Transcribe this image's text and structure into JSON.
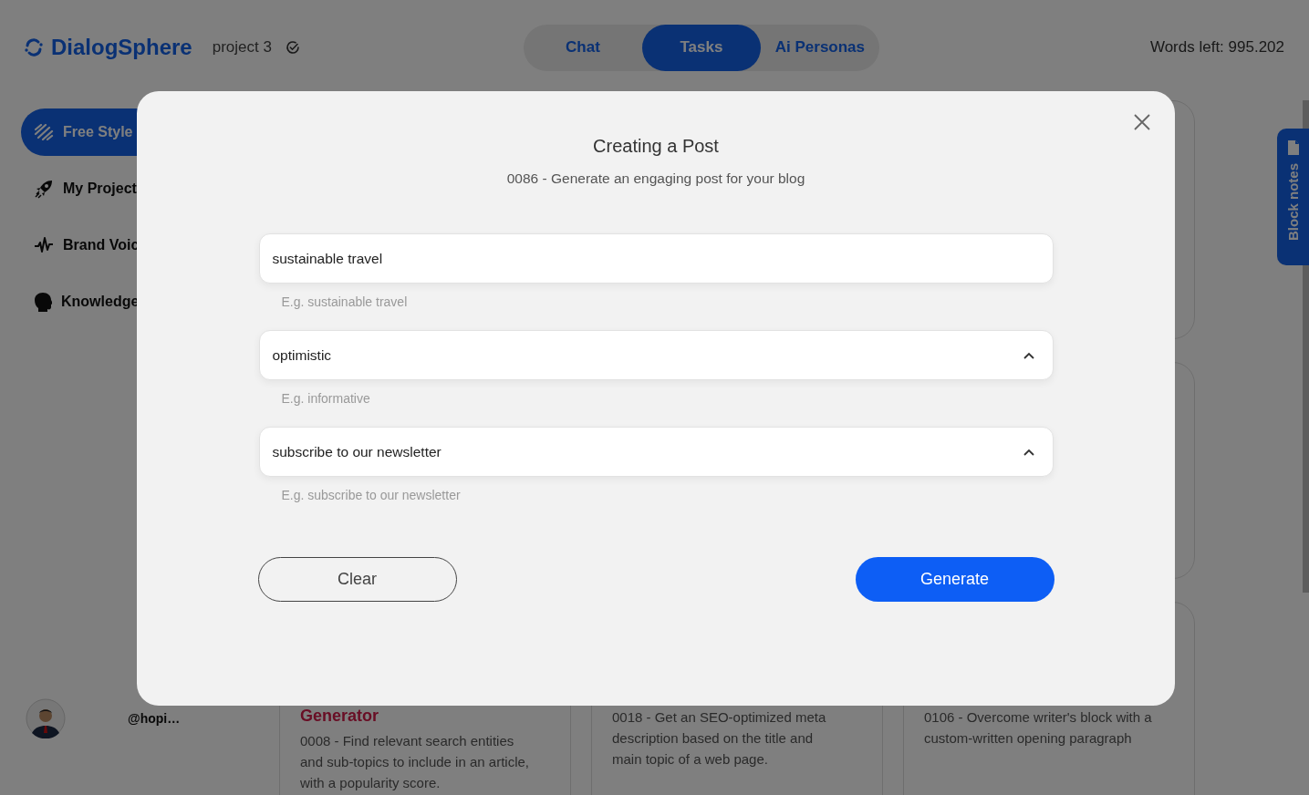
{
  "header": {
    "logo": "DialogSphere",
    "project": "project 3",
    "words_left": "Words left: 995.202"
  },
  "tabs": [
    {
      "label": "Chat",
      "selected": false
    },
    {
      "label": "Tasks",
      "selected": true
    },
    {
      "label": "Ai Personas",
      "selected": false
    }
  ],
  "sidebar": {
    "items": [
      {
        "label": "Free Style",
        "selected": true
      },
      {
        "label": "My Project",
        "selected": false
      },
      {
        "label": "Brand Voic",
        "selected": false
      },
      {
        "label": "Knowledge",
        "selected": false
      }
    ],
    "user": "@hopi…"
  },
  "cards": [
    {
      "title": "Generator",
      "description": "0008 - Find relevant search entities and sub-topics to include in an article, with a popularity score."
    },
    {
      "description": "0018 - Get an SEO-optimized meta description based on the title and main topic of a web page."
    },
    {
      "description": "0106 - Overcome writer's block with a custom-written opening paragraph"
    }
  ],
  "block_notes": "Block notes",
  "modal": {
    "title": "Creating a Post",
    "subtitle": "0086 - Generate an engaging post for your blog",
    "fields": [
      {
        "kind": "text",
        "value": "sustainable travel",
        "hint": "E.g. sustainable travel"
      },
      {
        "kind": "dropdown",
        "value": "optimistic",
        "hint": "E.g. informative"
      },
      {
        "kind": "dropdown",
        "value": "subscribe to our newsletter",
        "hint": "E.g. subscribe to our newsletter"
      }
    ],
    "buttons": [
      {
        "label": "Clear",
        "kind": "secondary"
      },
      {
        "label": "Generate",
        "kind": "primary"
      }
    ]
  }
}
